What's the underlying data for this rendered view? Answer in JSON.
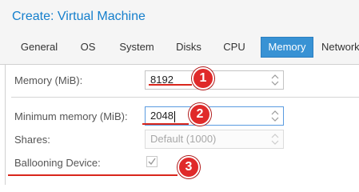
{
  "window": {
    "title": "Create: Virtual Machine"
  },
  "tabs": [
    {
      "label": "General",
      "active": false
    },
    {
      "label": "OS",
      "active": false
    },
    {
      "label": "System",
      "active": false
    },
    {
      "label": "Disks",
      "active": false
    },
    {
      "label": "CPU",
      "active": false
    },
    {
      "label": "Memory",
      "active": true
    },
    {
      "label": "Network",
      "active": false
    }
  ],
  "form": {
    "memory_label": "Memory (MiB):",
    "memory_value": "8192",
    "min_memory_label": "Minimum memory (MiB):",
    "min_memory_value": "2048",
    "shares_label": "Shares:",
    "shares_placeholder": "Default (1000)",
    "ballooning_label": "Ballooning Device:",
    "ballooning_checked": true
  },
  "annotations": [
    {
      "number": "1",
      "color": "#e02a2a"
    },
    {
      "number": "2",
      "color": "#e02a2a"
    },
    {
      "number": "3",
      "color": "#e02a2a"
    }
  ]
}
